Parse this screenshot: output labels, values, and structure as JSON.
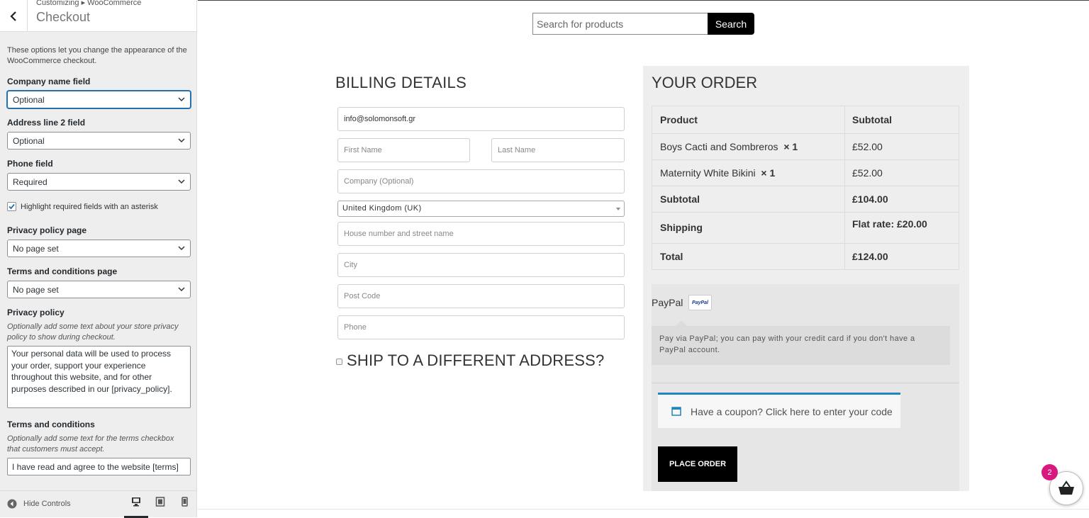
{
  "customizer": {
    "breadcrumb": "Customizing ▸ WooCommerce",
    "title": "Checkout",
    "description": "These options let you change the appearance of the WooCommerce checkout.",
    "company_field": {
      "label": "Company name field",
      "value": "Optional"
    },
    "address2_field": {
      "label": "Address line 2 field",
      "value": "Optional"
    },
    "phone_field": {
      "label": "Phone field",
      "value": "Required"
    },
    "highlight_required": {
      "label": "Highlight required fields with an asterisk",
      "checked": true
    },
    "privacy_page": {
      "label": "Privacy policy page",
      "value": "No page set"
    },
    "terms_page": {
      "label": "Terms and conditions page",
      "value": "No page set"
    },
    "privacy_policy": {
      "label": "Privacy policy",
      "help": "Optionally add some text about your store privacy policy to show during checkout.",
      "value": "Your personal data will be used to process your order, support your experience throughout this website, and for other purposes described in our [privacy_policy]."
    },
    "terms": {
      "label": "Terms and conditions",
      "help": "Optionally add some text for the terms checkbox that customers must accept.",
      "value": "I have read and agree to the website [terms]"
    },
    "footer": {
      "hide_controls": "Hide Controls"
    }
  },
  "preview": {
    "search": {
      "placeholder": "Search for products",
      "button": "Search"
    },
    "billing": {
      "heading": "BILLING DETAILS",
      "email": "info@solomonsoft.gr",
      "first_name": "First Name",
      "last_name": "Last Name",
      "company": "Company (Optional)",
      "country": "United Kingdom (UK)",
      "address": "House number and street name",
      "city": "City",
      "postcode": "Post Code",
      "phone": "Phone"
    },
    "ship_different": "SHIP TO A DIFFERENT ADDRESS?",
    "order": {
      "heading": "YOUR ORDER",
      "col_product": "Product",
      "col_subtotal": "Subtotal",
      "items": [
        {
          "name": "Boys Cacti and Sombreros",
          "qty": "× 1",
          "price": "£52.00"
        },
        {
          "name": "Maternity White Bikini",
          "qty": "× 1",
          "price": "£52.00"
        }
      ],
      "subtotal_label": "Subtotal",
      "subtotal": "£104.00",
      "shipping_label": "Shipping",
      "shipping": "Flat rate: £20.00",
      "total_label": "Total",
      "total": "£124.00"
    },
    "payment": {
      "method": "PayPal",
      "logo_text": "PayPal",
      "description": "Pay via PayPal; you can pay with your credit card if you don't have a PayPal account."
    },
    "coupon": "Have a coupon? Click here to enter your code",
    "place_order": "PLACE ORDER",
    "cart_count": "2"
  },
  "colors": {
    "accent": "#2271b1",
    "badge": "#d6187f",
    "coupon_border": "#1e85be"
  }
}
